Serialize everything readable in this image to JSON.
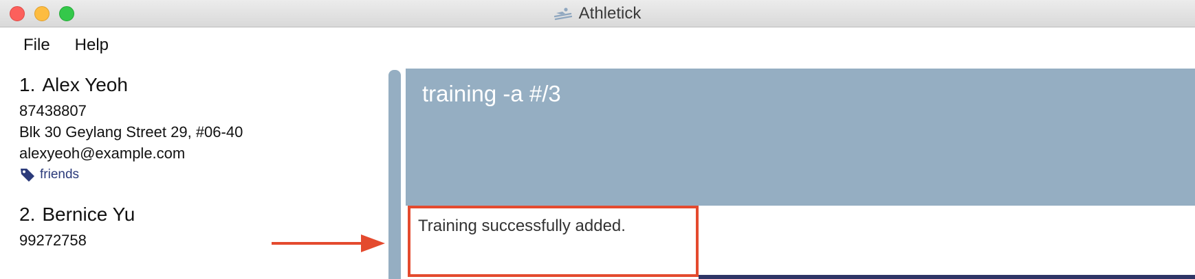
{
  "window": {
    "title": "Athletick",
    "app_icon": "skier-icon"
  },
  "menu": {
    "file": "File",
    "help": "Help"
  },
  "persons": [
    {
      "index": "1.",
      "name": "Alex Yeoh",
      "phone": "87438807",
      "address": "Blk 30 Geylang Street 29, #06-40",
      "email": "alexyeoh@example.com",
      "tag": "friends"
    },
    {
      "index": "2.",
      "name": "Bernice Yu",
      "phone": "99272758"
    }
  ],
  "command": {
    "text": "training -a #/3"
  },
  "result": {
    "text": "Training successfully added."
  },
  "colors": {
    "panel": "#95aec2",
    "highlight": "#e44a2e",
    "tag_text": "#2b3a7a",
    "bottom_bar": "#2e3566"
  }
}
